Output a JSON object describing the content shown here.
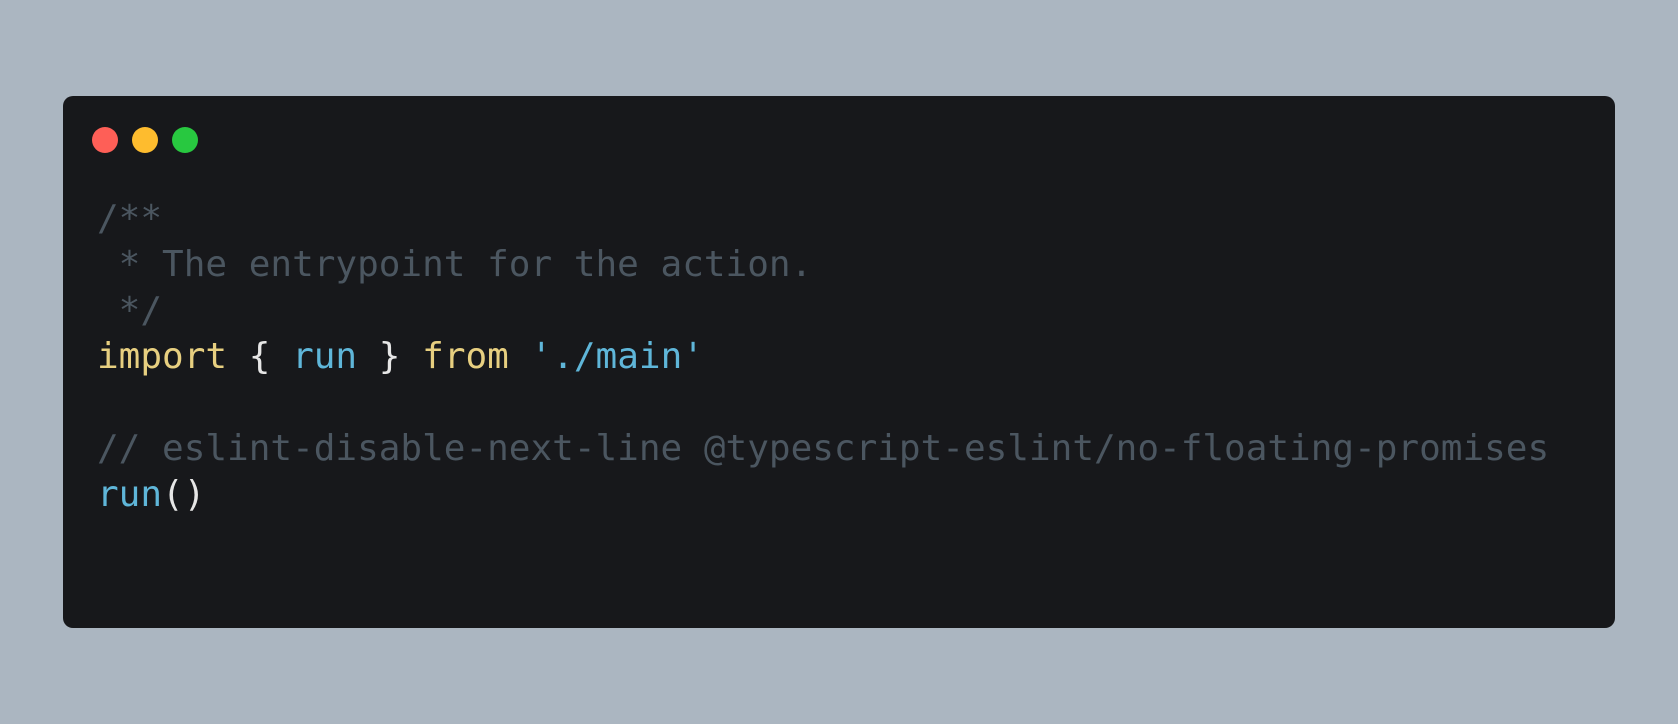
{
  "window": {
    "controls": [
      {
        "name": "close-icon",
        "color": "#fe5f57"
      },
      {
        "name": "minimize-icon",
        "color": "#febc2e"
      },
      {
        "name": "maximize-icon",
        "color": "#28c840"
      }
    ]
  },
  "code": {
    "line1": "/**",
    "line2": " * The entrypoint for the action.",
    "line3": " */",
    "line4": {
      "import_kw": "import",
      "brace_open": " { ",
      "run_ident": "run",
      "brace_close": " } ",
      "from_kw": "from",
      "space": " ",
      "module_path": "'./main'"
    },
    "line5": "",
    "line6": "// eslint-disable-next-line @typescript-eslint/no-floating-promises",
    "line7": {
      "run_call": "run",
      "parens": "()"
    }
  }
}
